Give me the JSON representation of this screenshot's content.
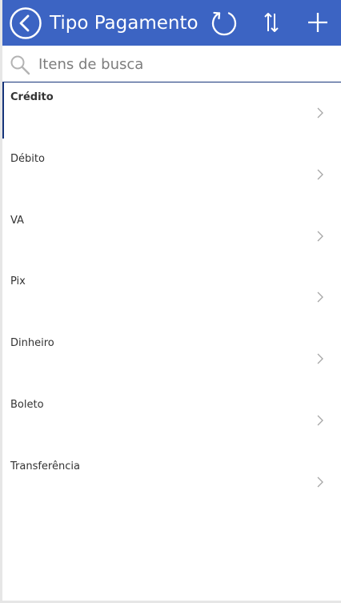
{
  "header": {
    "title": "Tipo Pagamento",
    "icons": [
      "back-circle-icon",
      "refresh-icon",
      "sort-icon",
      "plus-icon"
    ],
    "background": "#3c64c3"
  },
  "search": {
    "placeholder": "Itens de busca",
    "value": ""
  },
  "list": {
    "items": [
      {
        "label": "Crédito",
        "selected": true
      },
      {
        "label": "Débito",
        "selected": false
      },
      {
        "label": "VA",
        "selected": false
      },
      {
        "label": "Pix",
        "selected": false
      },
      {
        "label": "Dinheiro",
        "selected": false
      },
      {
        "label": "Boleto",
        "selected": false
      },
      {
        "label": "Transferência",
        "selected": false
      }
    ],
    "selected_color": "#16347a"
  }
}
